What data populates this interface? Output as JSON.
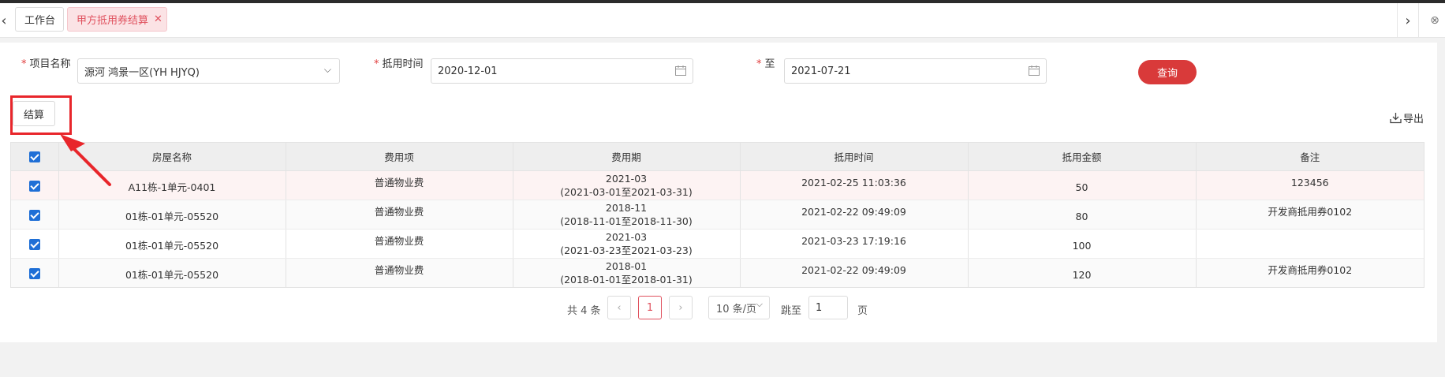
{
  "tabs": {
    "home": "工作台",
    "active": "甲方抵用券结算",
    "close_glyph": "✕"
  },
  "nav": {
    "left": "‹",
    "right": "›",
    "close_all": "⊗"
  },
  "filters": {
    "project_label": "项目名称",
    "project_value": "源河 鸿景一区(YH HJYQ)",
    "time_label": "抵用时间",
    "time_from": "2020-12-01",
    "to_label": "至",
    "time_to": "2021-07-21",
    "required_mark": "*",
    "query_button": "查询"
  },
  "actions": {
    "settle_button": "结算",
    "export_label": "导出"
  },
  "table": {
    "headers": [
      "房屋名称",
      "费用项",
      "费用期",
      "抵用时间",
      "抵用金额",
      "备注"
    ],
    "rows": [
      {
        "house": "A11栋-1单元-0401",
        "fee": "普通物业费",
        "period": "2021-03",
        "period_range": "(2021-03-01至2021-03-31)",
        "time": "2021-02-25 11:03:36",
        "amount": "50",
        "note": "123456"
      },
      {
        "house": "01栋-01单元-05520",
        "fee": "普通物业费",
        "period": "2018-11",
        "period_range": "(2018-11-01至2018-11-30)",
        "time": "2021-02-22 09:49:09",
        "amount": "80",
        "note": "开发商抵用券0102"
      },
      {
        "house": "01栋-01单元-05520",
        "fee": "普通物业费",
        "period": "2021-03",
        "period_range": "(2021-03-23至2021-03-23)",
        "time": "2021-03-23 17:19:16",
        "amount": "100",
        "note": ""
      },
      {
        "house": "01栋-01单元-05520",
        "fee": "普通物业费",
        "period": "2018-01",
        "period_range": "(2018-01-01至2018-01-31)",
        "time": "2021-02-22 09:49:09",
        "amount": "120",
        "note": "开发商抵用券0102"
      }
    ]
  },
  "pager": {
    "total": "共 4 条",
    "prev": "‹",
    "current": "1",
    "next": "›",
    "page_size": "10 条/页",
    "jump_label": "跳至",
    "jump_value": "1",
    "page_word": "页"
  },
  "colors": {
    "accent": "#d93a3a",
    "highlight": "#e8262b",
    "checkbox": "#1f6fd6"
  }
}
